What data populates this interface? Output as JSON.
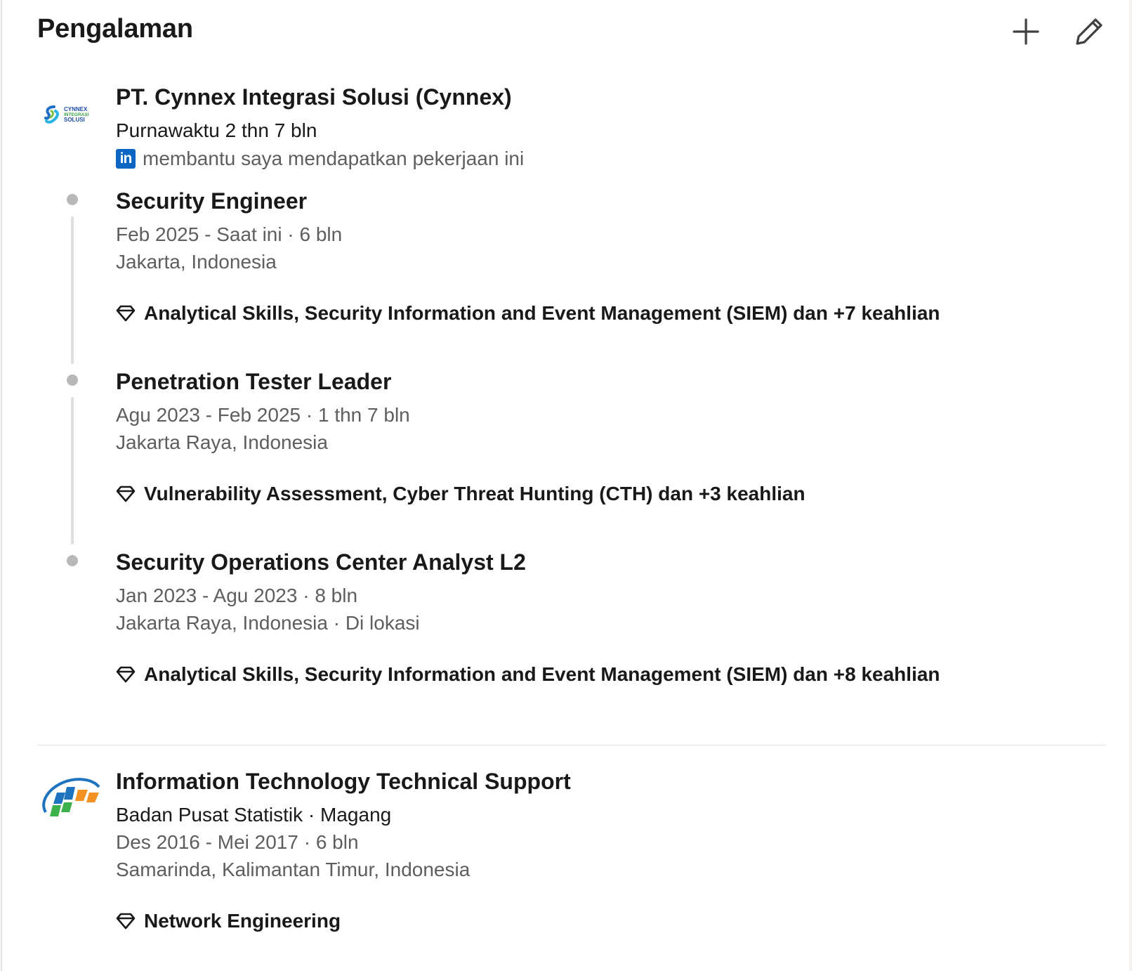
{
  "section": {
    "title": "Pengalaman"
  },
  "actions": {
    "add": "add-icon",
    "edit": "pencil-icon"
  },
  "experiences": [
    {
      "company": "PT. Cynnex Integrasi Solusi (Cynnex)",
      "logo_text": [
        "CYNNEX",
        "INTEGRASI",
        "SOLUSI"
      ],
      "employment": "Purnawaktu 2 thn 7 bln",
      "helped_text": "membantu saya mendapatkan pekerjaan ini",
      "helped_icon_text": "in",
      "roles": [
        {
          "title": "Security Engineer",
          "dates": "Feb 2025 - Saat ini · 6 bln",
          "location": "Jakarta, Indonesia",
          "skills": "Analytical Skills, Security Information and Event Management (SIEM) dan +7 keahlian"
        },
        {
          "title": "Penetration Tester Leader",
          "dates": "Agu 2023 - Feb 2025 · 1 thn 7 bln",
          "location": "Jakarta Raya, Indonesia",
          "skills": "Vulnerability Assessment, Cyber Threat Hunting (CTH) dan +3 keahlian"
        },
        {
          "title": "Security Operations Center Analyst L2",
          "dates": "Jan 2023 - Agu 2023 · 8 bln",
          "location": "Jakarta Raya, Indonesia · Di lokasi",
          "skills": "Analytical Skills, Security Information and Event Management (SIEM) dan +8 keahlian"
        }
      ]
    },
    {
      "title": "Information Technology Technical Support",
      "company": "Badan Pusat Statistik · Magang",
      "dates": "Des 2016 - Mei 2017 · 6 bln",
      "location": "Samarinda, Kalimantan Timur, Indonesia",
      "skills": "Network Engineering"
    }
  ],
  "colors": {
    "linkedin_blue": "#0a66c2",
    "timeline": "#b8b8b8",
    "muted_text": "#5e5e5e"
  }
}
